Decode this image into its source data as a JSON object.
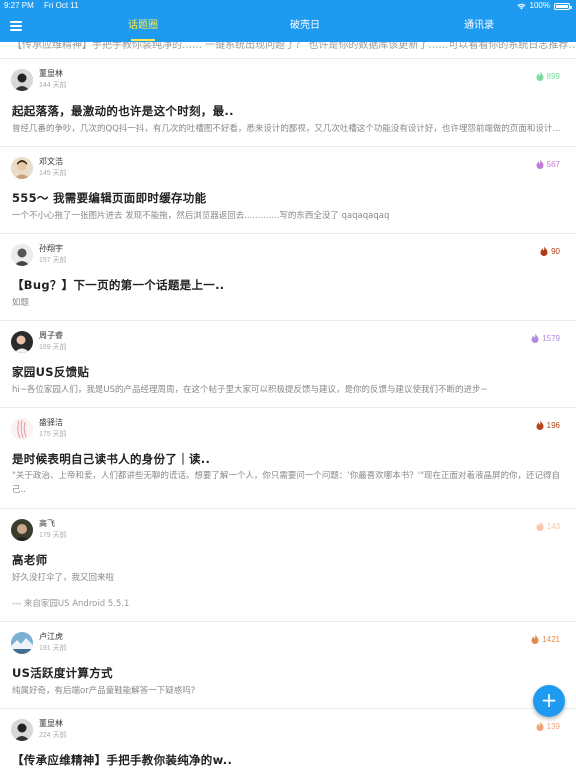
{
  "status_bar": {
    "time": "9:27 PM",
    "date": "Fri Oct 11",
    "battery": "100%"
  },
  "nav": {
    "menu_icon": "hamburger-menu-icon",
    "tabs": [
      {
        "label": "话题圈",
        "active": true
      },
      {
        "label": "破壳日",
        "active": false
      },
      {
        "label": "通讯录",
        "active": false
      }
    ]
  },
  "colors": {
    "primary": "#1e9bf0",
    "active_tab": "#ffe94d"
  },
  "partial_item": {
    "text": "【传承应维精神】手把手教你装纯净的…… 一键系统出现问题了？ 也许是你的数据库该更新了……可以看看你的系统日志推荐……"
  },
  "posts": [
    {
      "author": "董显林",
      "time": "144 天前",
      "heat": "899",
      "heat_color": "#7ddc9c",
      "title": "起起落落，最激动的也许是这个时刻，最..",
      "excerpt": "曾经几番的争吵，几次的QQ抖一抖，有几次的吐槽图不好看，悉来设计的鄙视，又几次吐槽这个功能没有设计好，也许埋怨前端做的页面和设计..."
    },
    {
      "author": "邓文浩",
      "time": "145 天前",
      "heat": "567",
      "heat_color": "#c47ad8",
      "title": "555～ 我需要编辑页面即时缓存功能",
      "excerpt": "一个不小心拖了一张图片进去 发现不能拖，然后浏览器返回去.............写的东西全没了 qaqaqaqaq"
    },
    {
      "author": "孙翔宇",
      "time": "157 天前",
      "heat": "90",
      "heat_color": "#b23a12",
      "title": "【Bug？】下一页的第一个话题是上一..",
      "excerpt": "如题"
    },
    {
      "author": "周子睿",
      "time": "169 天前",
      "heat": "1579",
      "heat_color": "#b48ae0",
      "title": "家园US反馈贴",
      "excerpt": "hi~各位家园人们，我是US的产品经理周周，在这个帖子里大家可以积极提反馈与建议，是你的反馈与建议使我们不断的进步~"
    },
    {
      "author": "盛驿洁",
      "time": "175 天前",
      "heat": "196",
      "heat_color": "#b5441a",
      "title": "是时候表明自己读书人的身份了｜读..",
      "excerpt": "\"关于政治、上帝和爱，人们都讲些无聊的谎话。想要了解一个人，你只需要问一个问题：'你最喜欢哪本书？'\"现在正面对着液晶屏的你，还记得自己.."
    },
    {
      "author": "高飞",
      "time": "179 天前",
      "heat": "143",
      "heat_color": "#f3c7a8",
      "title": "高老师",
      "excerpt": "好久没打伞了，我又回来啦",
      "signature": "--- 来自家园US Android 5.5.1"
    },
    {
      "author": "卢江虎",
      "time": "191 天前",
      "heat": "1421",
      "heat_color": "#e8894b",
      "title": "US活跃度计算方式",
      "excerpt": "纯属好奇，有后端or产品童鞋能解答一下疑惑吗?"
    },
    {
      "author": "董显林",
      "time": "224 天前",
      "heat": "139",
      "heat_color": "#f2a57a",
      "title": "【传承应维精神】手把手教你装纯净的w..",
      "excerpt": ""
    }
  ],
  "fab": {
    "label": "+",
    "icon": "plus-icon"
  }
}
